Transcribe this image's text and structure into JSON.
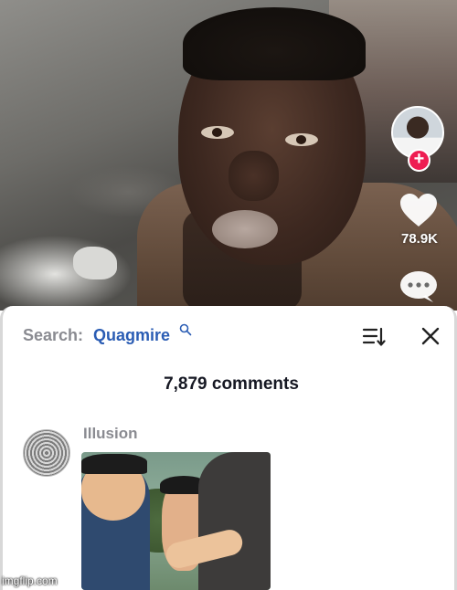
{
  "video": {
    "creator_avatar": "creator-avatar",
    "follow_symbol": "+",
    "like_count": "78.9K",
    "icons": {
      "like": "heart-icon",
      "comment": "speech-bubble-icon",
      "follow": "plus-icon"
    }
  },
  "comments_panel": {
    "search_label": "Search:",
    "search_term": "Quagmire",
    "comment_count": "7,879 comments",
    "icons": {
      "search": "search-icon",
      "sort": "sort-icon",
      "close": "close-icon"
    },
    "comments": [
      {
        "username": "Illusion",
        "attachment": "anime-screenshot"
      }
    ]
  },
  "watermark": "imgflip.com",
  "colors": {
    "follow_red": "#ee1d52",
    "search_term_blue": "#2b5db4",
    "muted_text": "#8a8b91",
    "heading_text": "#161823"
  }
}
